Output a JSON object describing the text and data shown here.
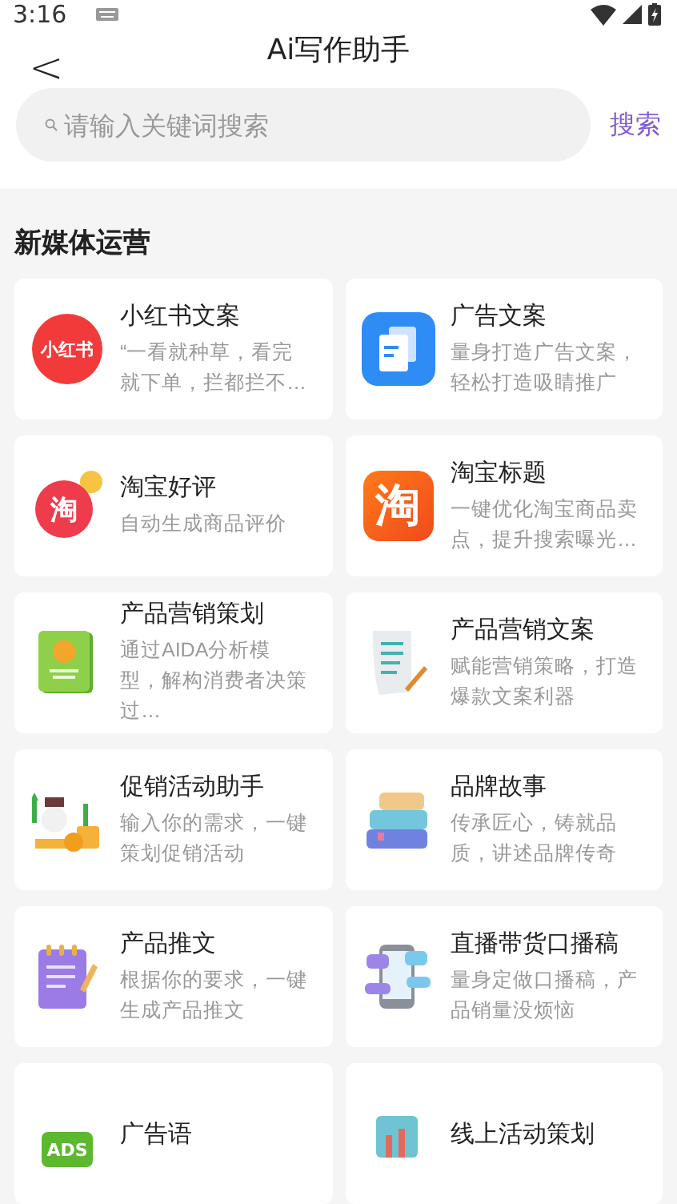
{
  "status_bar": {
    "time": "3:16"
  },
  "header": {
    "back": "<",
    "title": "Ai写作助手"
  },
  "search": {
    "placeholder": "请输入关键词搜索",
    "button": "搜索"
  },
  "section": {
    "title": "新媒体运营"
  },
  "cards": [
    {
      "kind": "redbook",
      "icon_text": "小红书",
      "title": "小红书文案",
      "description": "“一看就种草，看完就下单，拦都拦不…"
    },
    {
      "kind": "doc",
      "title": "广告文案",
      "description": "量身打造广告文案，轻松打造吸睛推广"
    },
    {
      "kind": "tao-round",
      "icon_text": "淘",
      "title": "淘宝好评",
      "description": "自动生成商品评价"
    },
    {
      "kind": "tao-square",
      "icon_text": "淘",
      "title": "淘宝标题",
      "description": "一键优化淘宝商品卖点，提升搜索曝光…"
    },
    {
      "kind": "green-book",
      "title": "产品营销策划",
      "description": "通过AIDA分析模型，解构消费者决策过…"
    },
    {
      "kind": "paper-pen",
      "title": "产品营销文案",
      "description": "赋能营销策略，打造爆款文案利器"
    },
    {
      "kind": "promo",
      "title": "促销活动助手",
      "description": "输入你的需求，一键策划促销活动"
    },
    {
      "kind": "books",
      "title": "品牌故事",
      "description": "传承匠心，铸就品质，讲述品牌传奇"
    },
    {
      "kind": "notepad",
      "title": "产品推文",
      "description": "根据你的要求，一键生成产品推文"
    },
    {
      "kind": "phone-chat",
      "title": "直播带货口播稿",
      "description": "量身定做口播稿，产品销量没烦恼"
    },
    {
      "kind": "ads",
      "icon_text": "ADS",
      "title": "广告语"
    },
    {
      "kind": "chart",
      "title": "线上活动策划"
    }
  ]
}
